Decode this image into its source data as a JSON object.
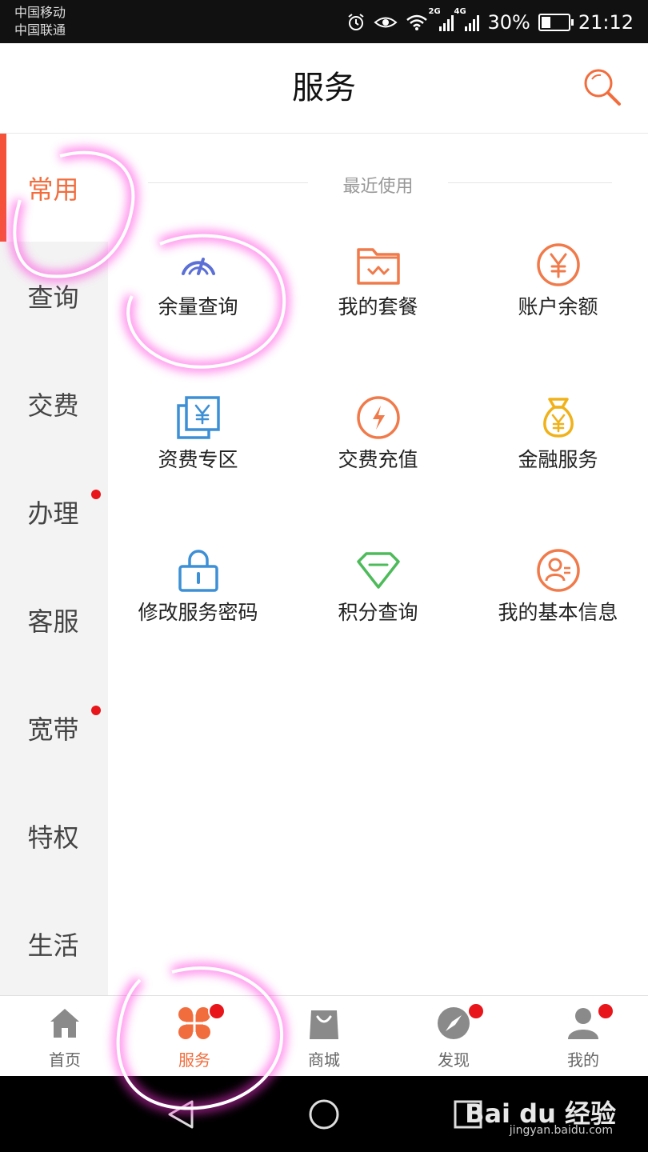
{
  "status": {
    "carrier1": "中国移动",
    "carrier2": "中国联通",
    "net1": "2G",
    "net2": "4G",
    "battery": "30%",
    "battery_level": 0.3,
    "time": "21:12",
    "alarm_icon": "alarm-icon",
    "eye_icon": "eye-comfort-icon",
    "wifi_icon": "wifi-icon"
  },
  "header": {
    "title": "服务",
    "search_icon": "search-icon"
  },
  "sidebar": {
    "items": [
      {
        "label": "常用",
        "active": true,
        "dot": false
      },
      {
        "label": "查询",
        "active": false,
        "dot": false
      },
      {
        "label": "交费",
        "active": false,
        "dot": false
      },
      {
        "label": "办理",
        "active": false,
        "dot": true
      },
      {
        "label": "客服",
        "active": false,
        "dot": false
      },
      {
        "label": "宽带",
        "active": false,
        "dot": true
      },
      {
        "label": "特权",
        "active": false,
        "dot": false
      },
      {
        "label": "生活",
        "active": false,
        "dot": false
      }
    ]
  },
  "section": {
    "title": "最近使用"
  },
  "services": [
    {
      "label": "余量查询",
      "icon": "gauge-icon",
      "color": "#5b6fd6"
    },
    {
      "label": "我的套餐",
      "icon": "package-folder-icon",
      "color": "#f07a4a"
    },
    {
      "label": "账户余额",
      "icon": "yuan-circle-icon",
      "color": "#f07a4a"
    },
    {
      "label": "资费专区",
      "icon": "yuan-cards-icon",
      "color": "#3d8fd6"
    },
    {
      "label": "交费充值",
      "icon": "lightning-circle-icon",
      "color": "#f07a4a"
    },
    {
      "label": "金融服务",
      "icon": "money-bag-icon",
      "color": "#f0b21a"
    },
    {
      "label": "修改服务密码",
      "icon": "lock-icon",
      "color": "#3d8fd6"
    },
    {
      "label": "积分查询",
      "icon": "diamond-icon",
      "color": "#4dbb5a"
    },
    {
      "label": "我的基本信息",
      "icon": "user-card-icon",
      "color": "#f07a4a"
    }
  ],
  "tabs": [
    {
      "label": "首页",
      "icon": "home-icon",
      "active": false,
      "dot": false
    },
    {
      "label": "服务",
      "icon": "clover-icon",
      "active": true,
      "dot": true
    },
    {
      "label": "商城",
      "icon": "shopping-bag-icon",
      "active": false,
      "dot": false
    },
    {
      "label": "发现",
      "icon": "compass-icon",
      "active": false,
      "dot": true
    },
    {
      "label": "我的",
      "icon": "person-icon",
      "active": false,
      "dot": true
    }
  ],
  "colors": {
    "accent": "#f26d3d",
    "badge": "#e8151b",
    "annotation": "#ff33dd"
  },
  "watermark": {
    "brand": "Bai du 经验",
    "url": "jingyan.baidu.com"
  }
}
